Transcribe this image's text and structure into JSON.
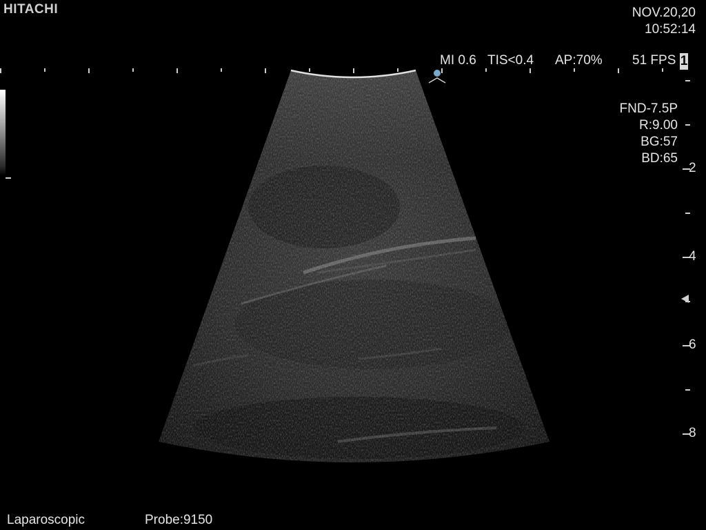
{
  "brand": "HITACHI",
  "date": "NOV.20,20",
  "time": "10:52:14",
  "status": {
    "mi": "MI 0.6",
    "tis": "TIS<0.4",
    "ap": "AP:70%",
    "fps": "51 FPS",
    "frame": "1"
  },
  "params": {
    "probe_model": "FND-7.5P",
    "range": "R:9.00",
    "gain": "BG:57",
    "dynamic": "BD:65"
  },
  "depth_scale": [
    "2",
    "4",
    "6",
    "8"
  ],
  "footer": {
    "mode": "Laparoscopic",
    "probe": "Probe:9150"
  },
  "colors": {
    "background": "#000000",
    "text": "#e6e6e6",
    "marker": "#7aa9c9"
  }
}
